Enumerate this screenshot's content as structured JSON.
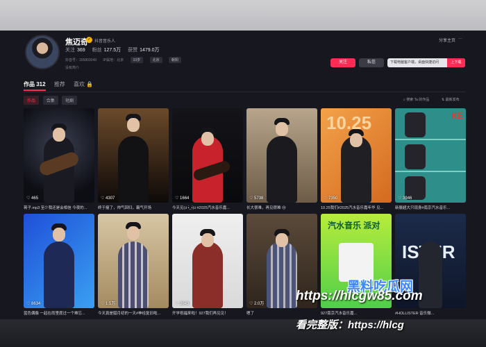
{
  "profile": {
    "name": "焦迈奇",
    "verified_label": "抖音音乐人",
    "following_label": "关注",
    "following": "369",
    "followers_label": "粉丝",
    "followers": "127.5万",
    "likes_label": "获赞",
    "likes": "1479.0万",
    "douyin_id": "抖音号：165803049",
    "ip_location": "IP属地：北京",
    "tags": [
      "33岁",
      "北京",
      "朝阳"
    ],
    "bio": "没有简介"
  },
  "header_actions": {
    "share": "分享主页",
    "more": "···"
  },
  "actions": {
    "follow": "关注",
    "message": "私信",
    "download_text": "下载电脑客户端，桌面快捷访问",
    "download_button": "上下载"
  },
  "tabs": [
    {
      "label": "作品 312"
    },
    {
      "label": "推荐"
    },
    {
      "label": "喜欢 🔒"
    }
  ],
  "subtabs": [
    "作品",
    "合集",
    "短剧"
  ],
  "search_works": "搜索 Ta 的作品",
  "sort": "最新发布",
  "videos": [
    {
      "likes": "465",
      "title": "蒋子.mp3 至少我还是会相信 今夜的..."
    },
    {
      "likes": "4307",
      "title": "终于瘦了，帅气回归，霸气开场"
    },
    {
      "likes": "1664",
      "title": "今天见(ง •̀_•́)ง #2025汽水音乐嘉..."
    },
    {
      "likes": "5738",
      "title": "长大很难，再见很难 😢"
    },
    {
      "likes": "7350",
      "title": "10.25我们#2025汽水音乐嘉年华 见..."
    },
    {
      "likes": "3946",
      "title": "新展超大只现身#南京汽水音乐..."
    },
    {
      "likes": "8634",
      "title": "蓝色偶像 一起在雨里度过一个难忘..."
    },
    {
      "likes": "1.5万",
      "title": "今天真是腊月初的一天#神经复旧啦..."
    },
    {
      "likes": "3643",
      "title": "开学祝福来啦！927我们再见见！"
    },
    {
      "likes": "2.0万",
      "title": "嗯了"
    },
    {
      "likes": "",
      "title": "927南京汽水音乐嘉..."
    },
    {
      "likes": "",
      "title": "#HOLLISTER 音乐微..."
    }
  ],
  "watermark": {
    "line1": "黑料吃瓜网",
    "line2": "https://hlcgw85.com",
    "line3": "看完整版：https://hlcg"
  },
  "colors": {
    "accent": "#fe2c55",
    "background": "#16171f"
  }
}
